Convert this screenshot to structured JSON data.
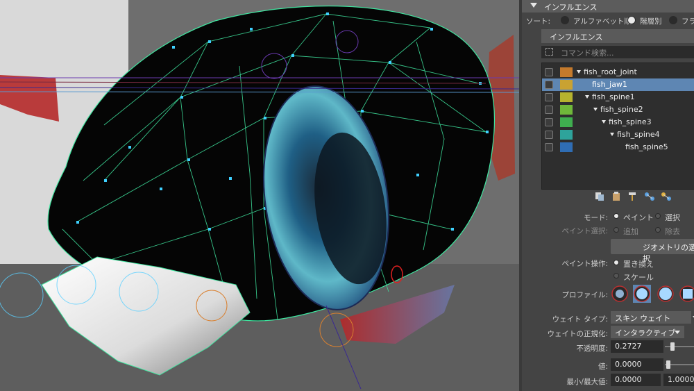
{
  "influence_panel": {
    "section_title": "インフルエンス",
    "sort_label": "ソート:",
    "sort_options": [
      "アルファベット順",
      "階層別",
      "フラ"
    ],
    "sub_title": "インフルエンス",
    "search_placeholder": "コマンド検索...",
    "joints": [
      {
        "name": "fish_root_joint",
        "color": "#c47a2c"
      },
      {
        "name": "fish_jaw1",
        "color": "#c9a232"
      },
      {
        "name": "fish_spine1",
        "color": "#b6b32e"
      },
      {
        "name": "fish_spine2",
        "color": "#6fb83a"
      },
      {
        "name": "fish_spine3",
        "color": "#3fae4f"
      },
      {
        "name": "fish_spine4",
        "color": "#2ea39b"
      },
      {
        "name": "fish_spine5",
        "color": "#2f6db4"
      }
    ],
    "selected_joint": "fish_jaw1"
  },
  "paint_settings": {
    "mode_label": "モード:",
    "mode_paint": "ペイント",
    "mode_select": "選択",
    "paint_select_label": "ペイント選択:",
    "add_label": "追加",
    "remove_label": "除去",
    "select_geometry_button": "ジオメトリの選択",
    "paint_op_label": "ペイント操作:",
    "op_replace": "置き換え",
    "op_scale": "スケール",
    "profile_label": "プロファイル:",
    "weight_type_label": "ウェイト タイプ:",
    "weight_type_value": "スキン ウェイト",
    "normalize_label": "ウェイトの正規化:",
    "normalize_value": "インタラクティブ",
    "opacity_label": "不透明度:",
    "opacity_value": "0.2727",
    "value_label": "値:",
    "value_value": "0.0000",
    "minmax_label": "最小/最大値:",
    "min_value": "0.0000",
    "max_value": "1.0000"
  },
  "colors": {
    "selection": "#5e86b3",
    "wireframe": "#3fe6a0",
    "vertex": "#3fd0ff"
  }
}
